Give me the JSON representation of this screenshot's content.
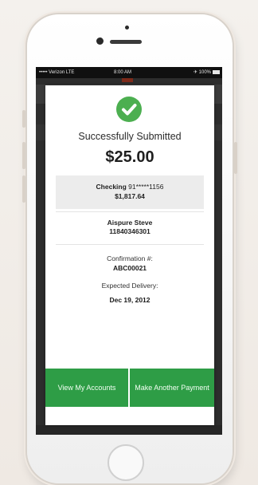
{
  "status_bar": {
    "carrier": "••••• Verizon LTE",
    "time": "8:00 AM",
    "right_status": "✈ 100%"
  },
  "confirmation": {
    "title": "Successfully Submitted",
    "amount": "$25.00",
    "account_type": "Checking",
    "account_number": "91*****1156",
    "account_balance": "$1,817.64",
    "payee_name": "Aispure Steve",
    "payee_number": "11840346301",
    "confirmation_label": "Confirmation #:",
    "confirmation_number": "ABC00021",
    "delivery_label": "Expected Delivery:",
    "delivery_date": "Dec 19, 2012"
  },
  "actions": {
    "view_accounts": "View My Accounts",
    "make_another_payment": "Make Another Payment"
  },
  "colors": {
    "accent_green": "#2e9d46",
    "check_green": "#4caf50"
  }
}
